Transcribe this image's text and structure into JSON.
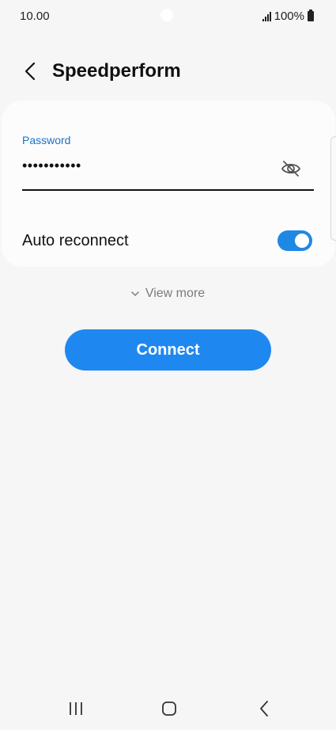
{
  "status_bar": {
    "time": "10.00",
    "battery": "100%",
    "icons": [
      "signal-icon",
      "battery-icon"
    ]
  },
  "header": {
    "back_icon": "chevron-left-icon",
    "title": "Speedperform"
  },
  "password": {
    "label": "Password",
    "value": "•••••••••••",
    "visibility_icon": "eye-slash-icon"
  },
  "auto_reconnect": {
    "label": "Auto reconnect",
    "enabled": true
  },
  "view_more": {
    "label": "View more",
    "icon": "chevron-down-icon"
  },
  "connect": {
    "label": "Connect"
  },
  "nav_bar": {
    "icons": [
      "recents-icon",
      "home-icon",
      "back-icon"
    ]
  },
  "colors": {
    "accent": "#1e88f0",
    "label_blue": "#1a73c8",
    "background": "#f6f6f6"
  }
}
